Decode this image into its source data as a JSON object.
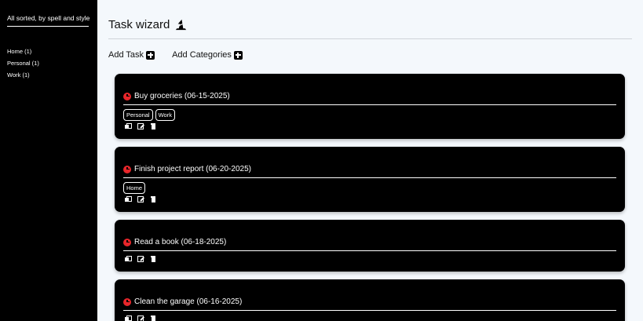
{
  "sidebar": {
    "tagline": "All sorted, by spell and style",
    "categories": [
      {
        "label": "Home (1)"
      },
      {
        "label": "Personal (1)"
      },
      {
        "label": "Work (1)"
      }
    ]
  },
  "header": {
    "title": "Task wizard",
    "icon": "wizard-hat-icon"
  },
  "actions": {
    "add_task": "Add Task",
    "add_categories": "Add Categories"
  },
  "tasks": [
    {
      "name": "Buy groceries (06-15-2025)",
      "tags": [
        "Personal",
        "Work"
      ]
    },
    {
      "name": "Finish project report (06-20-2025)",
      "tags": [
        "Home"
      ]
    },
    {
      "name": "Read a book (06-18-2025)",
      "tags": []
    },
    {
      "name": "Clean the garage (06-16-2025)",
      "tags": []
    }
  ],
  "colors": {
    "sidebar_bg": "#000000",
    "page_bg": "#f4f8fc",
    "card_bg": "#000000",
    "clock_red": "#e8262a"
  }
}
